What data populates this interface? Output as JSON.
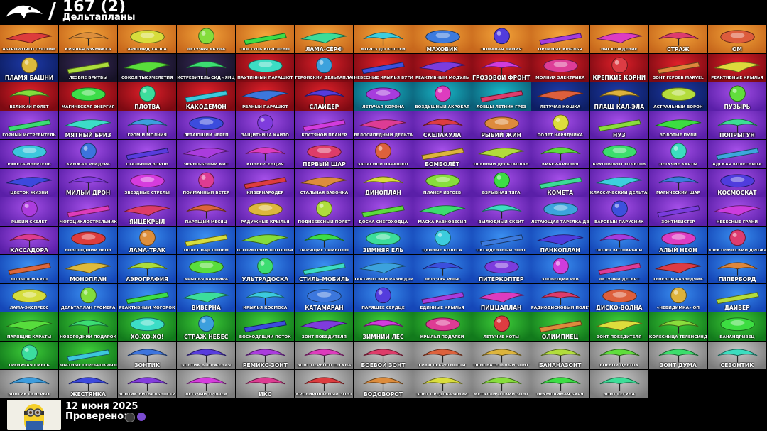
{
  "header": {
    "count_text": "167 (2)",
    "category": "Дельтапланы",
    "slash": "/"
  },
  "footer": {
    "date": "12 июня 2025",
    "checked_label": "Проверено:",
    "status_icons": [
      "epic-games-icon",
      "playstation-icon"
    ]
  },
  "rarity_colors": {
    "orange": [
      "#f4a53a",
      "#c8681c"
    ],
    "darkblue": [
      "#1e3aa8",
      "#0d1e63"
    ],
    "red": [
      "#e0202a",
      "#7d0a12"
    ],
    "dark": [
      "#3a2a5a",
      "#161226"
    ],
    "teal": [
      "#19b8c7",
      "#0b5f78"
    ],
    "purple": [
      "#a54fe8",
      "#5a1fa8"
    ],
    "blue": [
      "#3a8ff0",
      "#1547b8"
    ],
    "green": [
      "#3fcf3a",
      "#127a1c"
    ],
    "gray": [
      "#c9c9c9",
      "#7c7c7c"
    ]
  },
  "rows": [
    {
      "items": [
        {
          "n": "ASTROWORLD CYCLONE",
          "c": "orange"
        },
        {
          "n": "КРЫЛЬЯ ВЗЯМАКСА",
          "c": "orange"
        },
        {
          "n": "АРАХНИД ХАОСА",
          "c": "orange"
        },
        {
          "n": "ЛЕТУЧАЯ АКУЛА",
          "c": "orange"
        },
        {
          "n": "ПОСТУПЬ КОРОЛЕВЫ",
          "c": "orange"
        },
        {
          "n": "ЛАМА-СЁРФ",
          "c": "orange",
          "big": true
        },
        {
          "n": "МОРОЗ ДО КОСТЕЙ",
          "c": "orange"
        },
        {
          "n": "МАХОВИК",
          "c": "orange",
          "big": true
        },
        {
          "n": "ЛОМАНАЯ ЛИНИЯ",
          "c": "orange"
        },
        {
          "n": "ОРЛИНЫЕ КРЫЛЬЯ",
          "c": "orange"
        },
        {
          "n": "НИСХОЖДЕНИЕ",
          "c": "orange"
        },
        {
          "n": "СТРАЖ",
          "c": "orange",
          "big": true
        },
        {
          "n": "ОМ",
          "c": "orange",
          "big": true
        }
      ]
    },
    {
      "items": [
        {
          "n": "ПЛАМЯ БАШНИ",
          "c": "darkblue",
          "big": true
        },
        {
          "n": "ЛЕЗВИЕ БРИТВЫ",
          "c": "dark"
        },
        {
          "n": "СОКОЛ ТЫСЯЧЕЛЕТИЯ",
          "c": "dark"
        },
        {
          "n": "ИСТРЕБИТЕЛЬ СИД «ЯЙЦО»",
          "c": "dark"
        },
        {
          "n": "ПАУТИННЫЙ ПАРАШЮТ",
          "c": "red"
        },
        {
          "n": "ГЕРОЙСКИЙ ДЕЛЬТАПЛАН",
          "c": "red"
        },
        {
          "n": "НЕБЕСНЫЕ КРЫЛЬЯ БУГИ",
          "c": "red"
        },
        {
          "n": "РЕАКТИВНЫЙ МОДУЛЬ",
          "c": "red"
        },
        {
          "n": "ГРОЗОВОЙ ФРОНТ",
          "c": "red",
          "big": true
        },
        {
          "n": "МОЛНИЯ ЭЛЕКТРИКА",
          "c": "red"
        },
        {
          "n": "КРЕПКИЕ КОРНИ",
          "c": "red",
          "big": true
        },
        {
          "n": "ЗОНТ ГЕРОЕВ MARVEL",
          "c": "red"
        },
        {
          "n": "РЕАКТИВНЫЕ КРЫЛЬЯ",
          "c": "red"
        }
      ]
    },
    {
      "items": [
        {
          "n": "ВЕЛИКИЙ ПОЛЁТ",
          "c": "red"
        },
        {
          "n": "МАГИЧЕСКАЯ ЭНЕРГИЯ",
          "c": "red"
        },
        {
          "n": "ПЛОТВА",
          "c": "red",
          "big": true
        },
        {
          "n": "КАКОДЕМОН",
          "c": "red",
          "big": true
        },
        {
          "n": "РВАНЫЙ ПАРАШЮТ",
          "c": "red"
        },
        {
          "n": "СЛАЙДЕР",
          "c": "red",
          "big": true
        },
        {
          "n": "ЛЕТУЧАЯ КОРОНА",
          "c": "teal"
        },
        {
          "n": "ВОЗДУШНЫЙ АКРОБАТ",
          "c": "teal"
        },
        {
          "n": "ЛОВЦЫ ЛЕТНИХ ГРЁЗ",
          "c": "teal"
        },
        {
          "n": "ЛЕТУЧАЯ КОШКА",
          "c": "darkblue"
        },
        {
          "n": "ПЛАЩ КАЛ-ЭЛА",
          "c": "darkblue",
          "big": true
        },
        {
          "n": "АСТРАЛЬНЫЙ ВОРОН",
          "c": "darkblue"
        },
        {
          "n": "ПУЗЫРЬ",
          "c": "purple",
          "big": true
        }
      ]
    },
    {
      "items": [
        {
          "n": "ГОРНЫЙ ИСТРЕБИТЕЛЬ",
          "c": "purple"
        },
        {
          "n": "МЯТНЫЙ БРИЗ",
          "c": "purple",
          "big": true
        },
        {
          "n": "ГРОМ И МОЛНИЯ",
          "c": "purple"
        },
        {
          "n": "ЛЕТАЮЩИЙ ЧЕРЕП",
          "c": "purple"
        },
        {
          "n": "ЗАЩИТНИЦА КАЙТО",
          "c": "purple"
        },
        {
          "n": "КОСТЯНОЙ ПЛАНЕР",
          "c": "purple"
        },
        {
          "n": "ВЕЛОСИПЕДНЫЙ ДЕЛЬТАПЛАН",
          "c": "purple"
        },
        {
          "n": "СКЕЛАКУЛА",
          "c": "purple",
          "big": true
        },
        {
          "n": "РЫБИЙ ЖИН",
          "c": "purple",
          "big": true
        },
        {
          "n": "ПОЛЁТ НАРЯДЧИКА",
          "c": "purple"
        },
        {
          "n": "НУЗ",
          "c": "purple",
          "big": true
        },
        {
          "n": "ЗОЛОТЫЕ ПУЛИ",
          "c": "purple"
        },
        {
          "n": "ПОПРЫГУН",
          "c": "purple",
          "big": true
        }
      ]
    },
    {
      "items": [
        {
          "n": "РАКЕТА-ИНЕРТЕЛЬ",
          "c": "purple"
        },
        {
          "n": "КИНЖАЛ РЕЙДЕРА",
          "c": "purple"
        },
        {
          "n": "СТАЛЬНОЙ ВОРОН",
          "c": "purple"
        },
        {
          "n": "ЧЁРНО-БЕЛЫЙ КИТ",
          "c": "purple"
        },
        {
          "n": "КОНВЕРГЕНЦИЯ",
          "c": "purple"
        },
        {
          "n": "ПЕРВЫЙ ШАР",
          "c": "purple",
          "big": true
        },
        {
          "n": "ЗАПАСНОЙ ПАРАШЮТ",
          "c": "purple"
        },
        {
          "n": "БОМБОЛЁТ",
          "c": "purple",
          "big": true
        },
        {
          "n": "ОСЕННИЙ ДЕЛЬТАПЛАН",
          "c": "purple"
        },
        {
          "n": "КИБЕР-КРЫЛЬЯ",
          "c": "purple"
        },
        {
          "n": "КРУГОВОРОТ ОТЧЕТОВ",
          "c": "purple"
        },
        {
          "n": "ЛЕТУЧИЕ КАРТЫ",
          "c": "purple"
        },
        {
          "n": "АДСКАЯ КОЛЕСНИЦА",
          "c": "purple"
        }
      ]
    },
    {
      "items": [
        {
          "n": "ЦВЕТОК ЖИЗНИ",
          "c": "purple"
        },
        {
          "n": "МИЛЫЙ ДРОН",
          "c": "purple",
          "big": true
        },
        {
          "n": "ЗВЁЗДНЫЕ СТРЕЛЫ",
          "c": "purple"
        },
        {
          "n": "ПОЙМАННЫЙ ВЕТЕР",
          "c": "purple"
        },
        {
          "n": "КИБЕРНАРОДЁР",
          "c": "purple"
        },
        {
          "n": "СТАЛЬНАЯ БАБОЧКА",
          "c": "purple"
        },
        {
          "n": "ДИНОПЛАН",
          "c": "purple",
          "big": true
        },
        {
          "n": "ПЛАНЕР ИЗГОЕВ",
          "c": "purple"
        },
        {
          "n": "ВЗРЫВНАЯ ТЯГА",
          "c": "purple"
        },
        {
          "n": "КОМЕТА",
          "c": "purple",
          "big": true
        },
        {
          "n": "КЛАССИЧЕСКИЙ ДЕЛЬТАПЛАН",
          "c": "purple"
        },
        {
          "n": "МАГИЧЕСКИЙ ШАР",
          "c": "purple"
        },
        {
          "n": "КОСМОСКАТ",
          "c": "purple",
          "big": true
        }
      ]
    },
    {
      "items": [
        {
          "n": "РЫБИЙ СКЕЛЕТ",
          "c": "purple"
        },
        {
          "n": "МОТОЦИКЛОСТРЕЛЬНИК",
          "c": "purple"
        },
        {
          "n": "ЯЙЦЕКРЫЛ",
          "c": "purple",
          "big": true
        },
        {
          "n": "ПАРЯЩИЙ МЕСЯЦ",
          "c": "purple"
        },
        {
          "n": "РАДУЖНЫЕ КРЫЛЬЯ",
          "c": "purple"
        },
        {
          "n": "ПОДНЕБЕСНЫЙ ПОЛЁТ",
          "c": "purple"
        },
        {
          "n": "ДОСКА СНЕГОХОДЦА",
          "c": "purple"
        },
        {
          "n": "МАСКА РАВНОВЕСИЯ",
          "c": "purple"
        },
        {
          "n": "ВЫЛЮДНЫЙ СКЕЙТ",
          "c": "purple"
        },
        {
          "n": "ЛЕТАЮЩАЯ ТАРЕЛКА ДВИКИ",
          "c": "purple"
        },
        {
          "n": "ВАРОВЫЙ ПАРУСНИК",
          "c": "purple"
        },
        {
          "n": "ЗОНТМЕЙСТЕР",
          "c": "purple"
        },
        {
          "n": "НЕБЕСНЫЕ ГРАНИ",
          "c": "purple"
        }
      ]
    },
    {
      "items": [
        {
          "n": "КАССАДОРА",
          "c": "purple",
          "big": true
        },
        {
          "n": "НОВОГОДНИЙ НЕОН",
          "c": "blue"
        },
        {
          "n": "ЛАМА-ТРАК",
          "c": "blue",
          "big": true
        },
        {
          "n": "ПОЛЁТ НАД ПОЛЕМ",
          "c": "blue"
        },
        {
          "n": "ШТОРМОВОЙ ПОТОШКА",
          "c": "blue"
        },
        {
          "n": "ПАРЯЩИЕ СИМВОЛЫ",
          "c": "blue"
        },
        {
          "n": "ЗИМНЯЯ ЕЛЬ",
          "c": "blue",
          "big": true
        },
        {
          "n": "ЦЕННЫЕ КОЛЁСА",
          "c": "blue"
        },
        {
          "n": "ОКСИДЕНТНЫЙ ЗОНТ",
          "c": "blue"
        },
        {
          "n": "ПАНКОПЛАН",
          "c": "blue",
          "big": true
        },
        {
          "n": "ПОЛЁТ КОТОКРЫСИ",
          "c": "blue"
        },
        {
          "n": "АЛЫЙ НЕОН",
          "c": "blue",
          "big": true
        },
        {
          "n": "ЭЛЕКТРИЧЕСКИЙ ДРОЖАЩИЙ",
          "c": "blue"
        }
      ]
    },
    {
      "items": [
        {
          "n": "БОЛЬШОЙ КУШ",
          "c": "blue"
        },
        {
          "n": "МОНОПЛАН",
          "c": "blue",
          "big": true
        },
        {
          "n": "АЭРОГРАФИЯ",
          "c": "blue",
          "big": true
        },
        {
          "n": "КРЫЛЬЯ ВАМПИРА",
          "c": "blue"
        },
        {
          "n": "УЛЬТРАДОСКА",
          "c": "blue",
          "big": true
        },
        {
          "n": "СТИЛЬ-МОБИЛЬ",
          "c": "blue",
          "big": true
        },
        {
          "n": "ТАКТИЧЕСКИЙ РАЗВЕДЧИК",
          "c": "blue"
        },
        {
          "n": "ЛЕТУЧАЯ РЫБА",
          "c": "blue"
        },
        {
          "n": "ПИТЕРКОПТЕР",
          "c": "blue",
          "big": true
        },
        {
          "n": "ЗЛОВЕЩИЙ РЁВ",
          "c": "blue"
        },
        {
          "n": "ЛЕТУЧИЙ ДЕСЕРТ",
          "c": "blue"
        },
        {
          "n": "ТЕНЕВОЙ РАЗВЕДЧИК",
          "c": "blue"
        },
        {
          "n": "ГИПЕРБОРД",
          "c": "blue",
          "big": true
        }
      ]
    },
    {
      "items": [
        {
          "n": "ЛАМА-ЭКСПРЕСС",
          "c": "blue"
        },
        {
          "n": "ДЕЛЬТАПЛАН ГРОМЕРА",
          "c": "blue"
        },
        {
          "n": "РЕАКТИВНЫЙ МОГОРОК",
          "c": "blue"
        },
        {
          "n": "ВИВЕРНА",
          "c": "blue",
          "big": true
        },
        {
          "n": "КРЫЛЬЯ КОСМОСА",
          "c": "blue"
        },
        {
          "n": "КАТАМАРАН",
          "c": "blue",
          "big": true
        },
        {
          "n": "ПАРЯЩЕЕ СЕРДЦЕ",
          "c": "blue"
        },
        {
          "n": "ЕДИННЫЕ КРЫЛЬЯ",
          "c": "blue"
        },
        {
          "n": "ПИЦЦАПЛАН",
          "c": "blue",
          "big": true
        },
        {
          "n": "РАДИОДИСКОВЫЙ ПОЛЁТ",
          "c": "blue"
        },
        {
          "n": "ДИСКО-ВОЛНА",
          "c": "blue",
          "big": true
        },
        {
          "n": "«НЕВИДИМКА» ОП",
          "c": "blue"
        },
        {
          "n": "ДАЙВЕР",
          "c": "blue",
          "big": true
        }
      ]
    },
    {
      "items": [
        {
          "n": "ПАРЯЩИЕ КАРАТЫ",
          "c": "green"
        },
        {
          "n": "НОВОГОДНИЙ ПОДАРОК",
          "c": "green"
        },
        {
          "n": "ХО-ХО-ХО!",
          "c": "green",
          "big": true
        },
        {
          "n": "СТРАЖ НЕБЕС",
          "c": "green",
          "big": true
        },
        {
          "n": "ВОСХОДЯЩИЙ ПОТОК",
          "c": "green"
        },
        {
          "n": "ЗОНТ ПОБЕДИТЕЛЯ",
          "c": "green"
        },
        {
          "n": "ЗИМНИЙ ЛЕС",
          "c": "green",
          "big": true
        },
        {
          "n": "КРЫЛЬЯ ПОДАРКИ",
          "c": "green"
        },
        {
          "n": "ЛЕТУЧИЕ КОТЫ",
          "c": "green"
        },
        {
          "n": "ОЛИМПИЕЦ",
          "c": "green",
          "big": true
        },
        {
          "n": "ЗОНТ ПОБЕДИТЕЛЯ",
          "c": "green"
        },
        {
          "n": "КОЛЕСНИЦА ТЕЛЕНСИНДА",
          "c": "green"
        },
        {
          "n": "БАНАНДРИВЕЦ",
          "c": "green"
        }
      ]
    },
    {
      "items": [
        {
          "n": "ГРЕНУЧАЯ СМЕСЬ",
          "c": "green"
        },
        {
          "n": "ЗЛАТНЫЕ СЕРЕБРОКРЫЛЬЯ",
          "c": "green"
        },
        {
          "n": "ЗОНТИК",
          "c": "gray",
          "big": true
        },
        {
          "n": "ЗОНТИК ВТОРЖЕНИЯ",
          "c": "gray"
        },
        {
          "n": "РЕМИКС-ЗОНТ",
          "c": "gray",
          "big": true
        },
        {
          "n": "ЗОНТ ПЕРВОГО СЁГУНА",
          "c": "gray"
        },
        {
          "n": "БОЕВОЙ ЗОНТ",
          "c": "gray",
          "big": true
        },
        {
          "n": "ГРИФ СЕКРЕТНОСТИ",
          "c": "gray"
        },
        {
          "n": "ОСНОВАТЕЛЬНЫЙ ЗОНТ",
          "c": "gray"
        },
        {
          "n": "БАНАНАЗОНТ",
          "c": "gray",
          "big": true
        },
        {
          "n": "БОЕВОЙ ЦВЕТОК",
          "c": "gray"
        },
        {
          "n": "ЗОНТ ДУМА",
          "c": "gray",
          "big": true
        },
        {
          "n": "СЕЗОНТИК",
          "c": "gray",
          "big": true
        }
      ]
    },
    {
      "items": [
        {
          "n": "ЗОНТИК СЕНЕРЫХ",
          "c": "gray"
        },
        {
          "n": "ЖЕСТЯНКА",
          "c": "gray",
          "big": true
        },
        {
          "n": "ЗОНТИК ВИТВАЛЬНОСТИ",
          "c": "gray"
        },
        {
          "n": "ЛЕТУЧИЙ ТРОФЕЙ",
          "c": "gray"
        },
        {
          "n": "ИКС",
          "c": "gray",
          "big": true
        },
        {
          "n": "КРОНИРОВАННЫЙ ЗОНТ",
          "c": "gray"
        },
        {
          "n": "ВОДОВОРОТ",
          "c": "gray",
          "big": true
        },
        {
          "n": "ЗОНТ ПРЕДСКАЗАНИЙ",
          "c": "gray"
        },
        {
          "n": "МЕТАЛЛИЧЕСКИЙ ЗОНТ",
          "c": "gray"
        },
        {
          "n": "НЕУМОЛИМАЯ БУРЯ",
          "c": "gray"
        },
        {
          "n": "ЗОНТ СЁГУНА",
          "c": "gray"
        }
      ]
    }
  ]
}
